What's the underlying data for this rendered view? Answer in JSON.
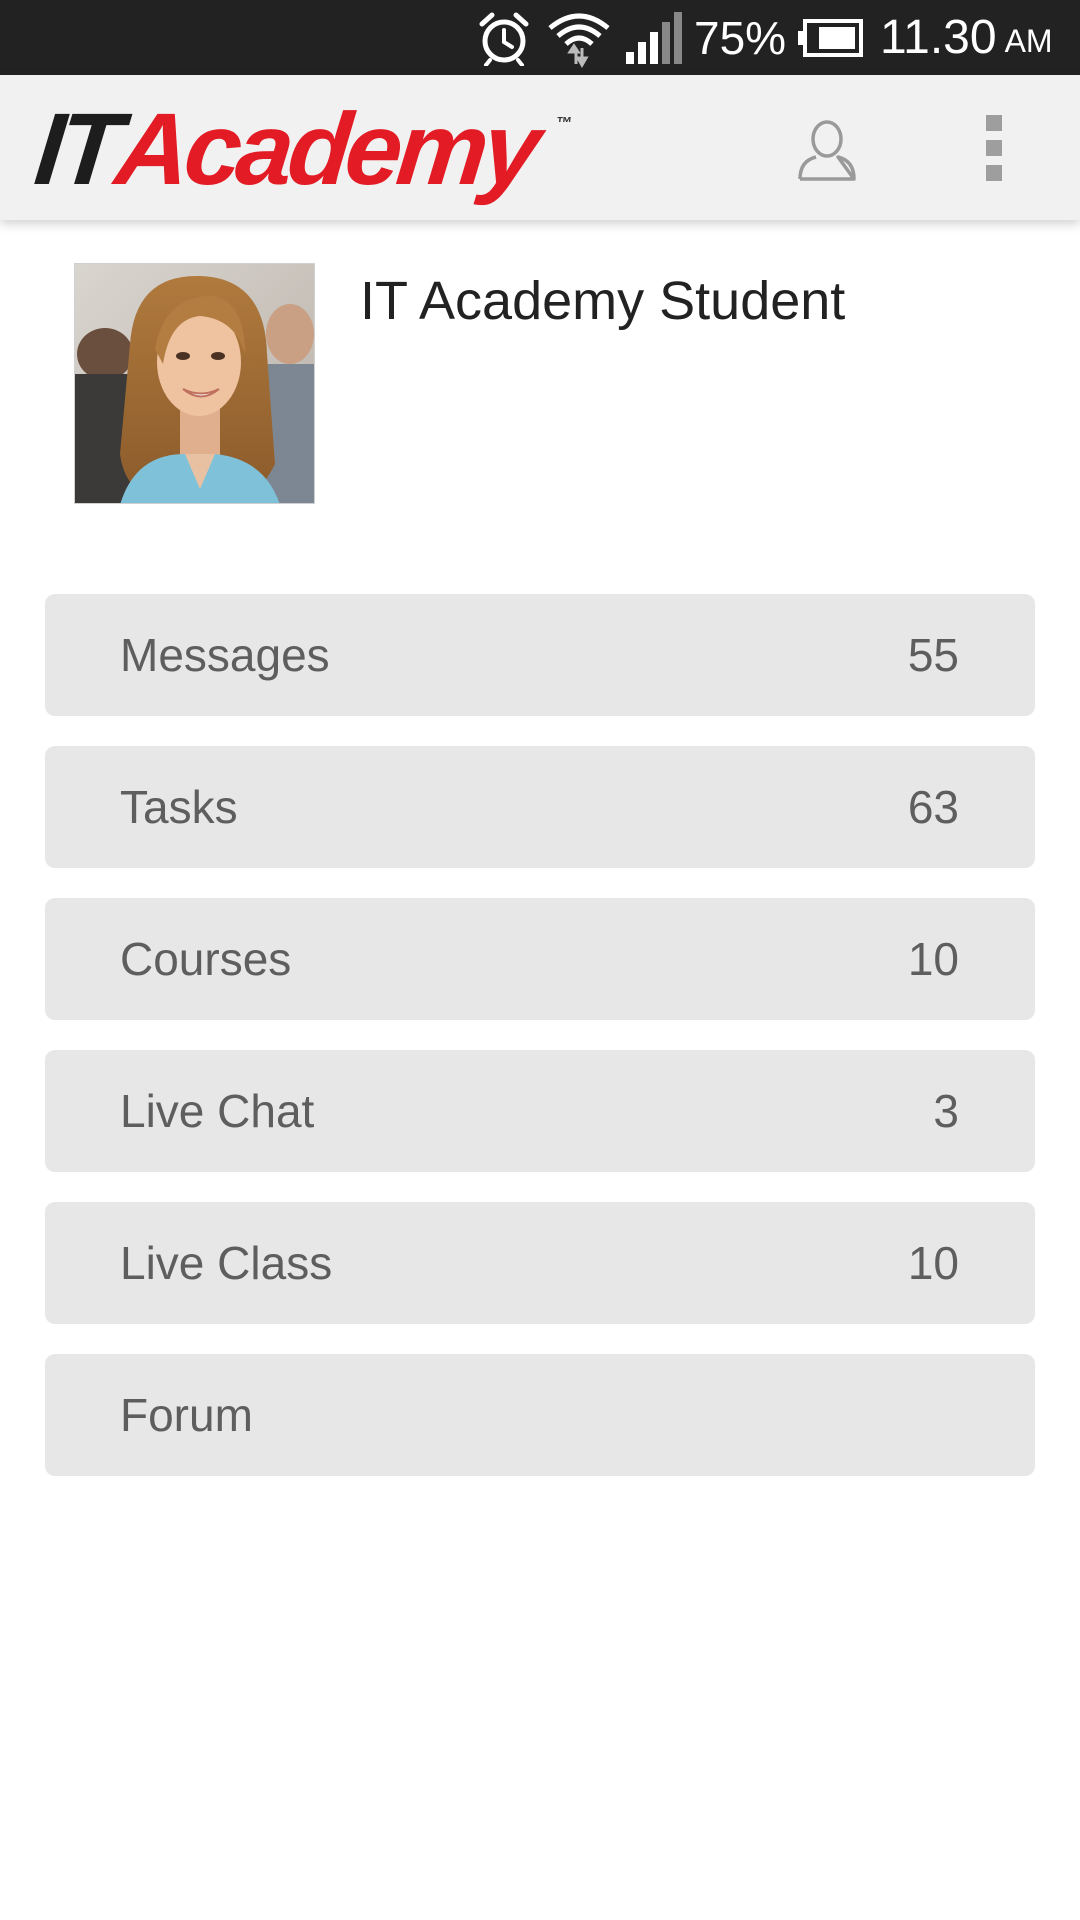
{
  "status_bar": {
    "battery_percent": "75%",
    "time": "11.30",
    "ampm": "AM",
    "icons": [
      "alarm-icon",
      "wifi-icon",
      "signal-icon",
      "battery-icon"
    ]
  },
  "app_bar": {
    "logo_part1": "IT",
    "logo_part2": "Academy",
    "logo_tm": "™",
    "icons": [
      "user-icon",
      "overflow-menu-icon"
    ],
    "brand_color": "#e21b24"
  },
  "profile": {
    "name": "IT Academy Student"
  },
  "menu": {
    "items": [
      {
        "label": "Messages",
        "count": "55"
      },
      {
        "label": "Tasks",
        "count": "63"
      },
      {
        "label": "Courses",
        "count": "10"
      },
      {
        "label": "Live Chat",
        "count": "3"
      },
      {
        "label": "Live Class",
        "count": "10"
      },
      {
        "label": "Forum",
        "count": ""
      }
    ]
  }
}
